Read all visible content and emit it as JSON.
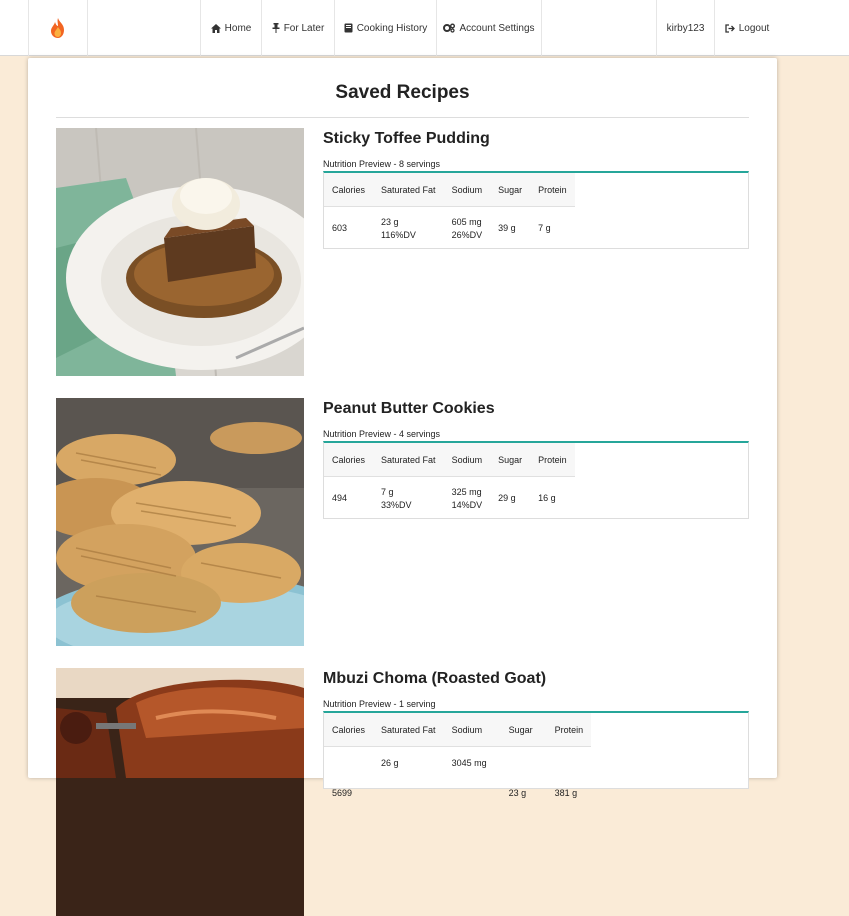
{
  "navbar": {
    "brand_icon": "flame-icon",
    "items": [
      {
        "label": "Home",
        "icon": "home-icon"
      },
      {
        "label": "For Later",
        "icon": "pin-icon"
      },
      {
        "label": "Cooking History",
        "icon": "book-icon"
      },
      {
        "label": "Account Settings",
        "icon": "gears-icon"
      }
    ],
    "username": "kirby123",
    "logout_label": "Logout",
    "logout_icon": "logout-icon"
  },
  "page": {
    "title": "Saved Recipes"
  },
  "table_headers": [
    "Calories",
    "Saturated Fat",
    "Sodium",
    "Sugar",
    "Protein"
  ],
  "recipes": [
    {
      "name": "Sticky Toffee Pudding",
      "caption": "Nutrition Preview - 8 servings",
      "calories": "603",
      "sat_fat": "23 g",
      "sat_fat_dv": "116%DV",
      "sodium": "605 mg",
      "sodium_dv": "26%DV",
      "sugar": "39 g",
      "protein": "7 g"
    },
    {
      "name": "Peanut Butter Cookies",
      "caption": "Nutrition Preview - 4 servings",
      "calories": "494",
      "sat_fat": "7 g",
      "sat_fat_dv": "33%DV",
      "sodium": "325 mg",
      "sodium_dv": "14%DV",
      "sugar": "29 g",
      "protein": "16 g"
    },
    {
      "name": "Mbuzi Choma (Roasted Goat)",
      "caption": "Nutrition Preview - 1 serving",
      "calories": "5699",
      "sat_fat": "26 g",
      "sodium": "3045 mg",
      "sugar": "23 g",
      "protein": "381 g"
    }
  ],
  "colors": {
    "page_background": "#faebd7",
    "accent_teal": "#26a69a",
    "flame": "#f26522"
  }
}
